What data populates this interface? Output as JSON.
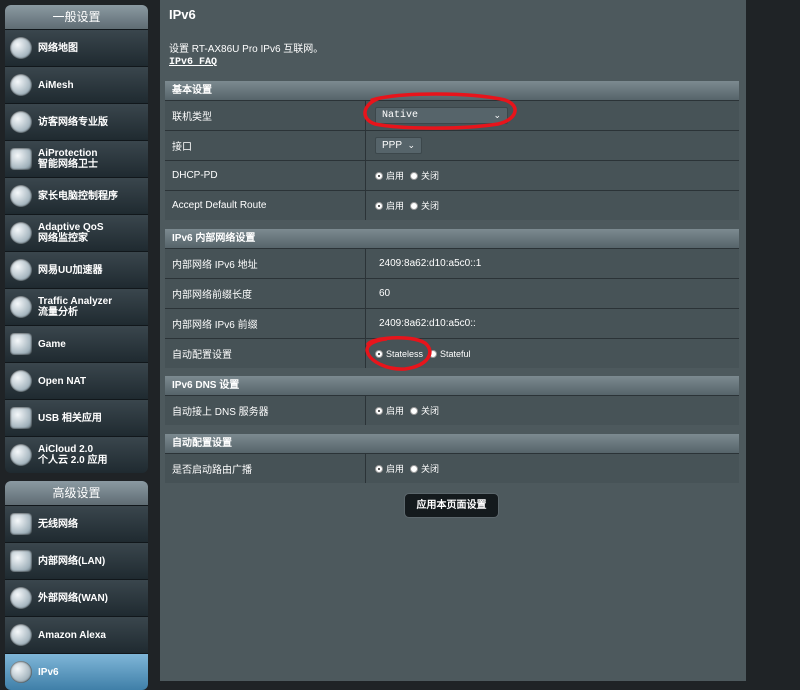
{
  "sidebar": {
    "general_header": "一般设置",
    "general_items": [
      {
        "icon": "globe-network-icon",
        "label": "网络地图",
        "sub": ""
      },
      {
        "icon": "aimesh-icon",
        "label": "AiMesh",
        "sub": ""
      },
      {
        "icon": "guest-network-icon",
        "label": "访客网络专业版",
        "sub": ""
      },
      {
        "icon": "shield-icon",
        "label": "AiProtection",
        "sub": "智能网络卫士"
      },
      {
        "icon": "parental-control-icon",
        "label": "家长电脑控制程序",
        "sub": ""
      },
      {
        "icon": "qos-gauge-icon",
        "label": "Adaptive QoS",
        "sub": "网络监控家"
      },
      {
        "icon": "speedometer-icon",
        "label": "网易UU加速器",
        "sub": ""
      },
      {
        "icon": "traffic-analyzer-icon",
        "label": "Traffic Analyzer",
        "sub": "流量分析"
      },
      {
        "icon": "gamepad-icon",
        "label": "Game",
        "sub": ""
      },
      {
        "icon": "open-nat-icon",
        "label": "Open NAT",
        "sub": ""
      },
      {
        "icon": "usb-icon",
        "label": "USB 相关应用",
        "sub": ""
      },
      {
        "icon": "aicloud-icon",
        "label": "AiCloud 2.0",
        "sub": "个人云 2.0 应用"
      }
    ],
    "advanced_header": "高级设置",
    "advanced_items": [
      {
        "icon": "wireless-icon",
        "label": "无线网络"
      },
      {
        "icon": "lan-icon",
        "label": "内部网络(LAN)"
      },
      {
        "icon": "wan-globe-icon",
        "label": "外部网络(WAN)"
      },
      {
        "icon": "alexa-icon",
        "label": "Amazon Alexa"
      },
      {
        "icon": "ipv6-icon",
        "label": "IPv6"
      }
    ]
  },
  "main": {
    "title": "IPv6",
    "description": "设置 RT-AX86U Pro IPv6 互联网。",
    "faq_link": "IPv6 FAQ",
    "basic": {
      "header": "基本设置",
      "connection_type_label": "联机类型",
      "connection_type_value": "Native",
      "interface_label": "接口",
      "interface_value": "PPP",
      "dhcp_pd_label": "DHCP-PD",
      "accept_route_label": "Accept Default Route"
    },
    "lan": {
      "header": "IPv6 内部网络设置",
      "lan_addr_label": "内部网络 IPv6 地址",
      "lan_addr_value": "2409:8a62:d10:a5c0::1",
      "prefix_len_label": "内部网络前缀长度",
      "prefix_len_value": "60",
      "prefix_label": "内部网络 IPv6 前缀",
      "prefix_value": "2409:8a62:d10:a5c0::",
      "autoconf_label": "自动配置设置",
      "stateless": "Stateless",
      "stateful": "Stateful"
    },
    "dns": {
      "header": "IPv6 DNS 设置",
      "auto_dns_label": "自动接上 DNS 服务器"
    },
    "auto": {
      "header": "自动配置设置",
      "router_adv_label": "是否启动路由广播"
    },
    "enable": "启用",
    "disable": "关闭",
    "apply_button": "应用本页面设置"
  },
  "colors": {
    "annotation": "#e8141b",
    "panel_bg": "#4d595d"
  }
}
